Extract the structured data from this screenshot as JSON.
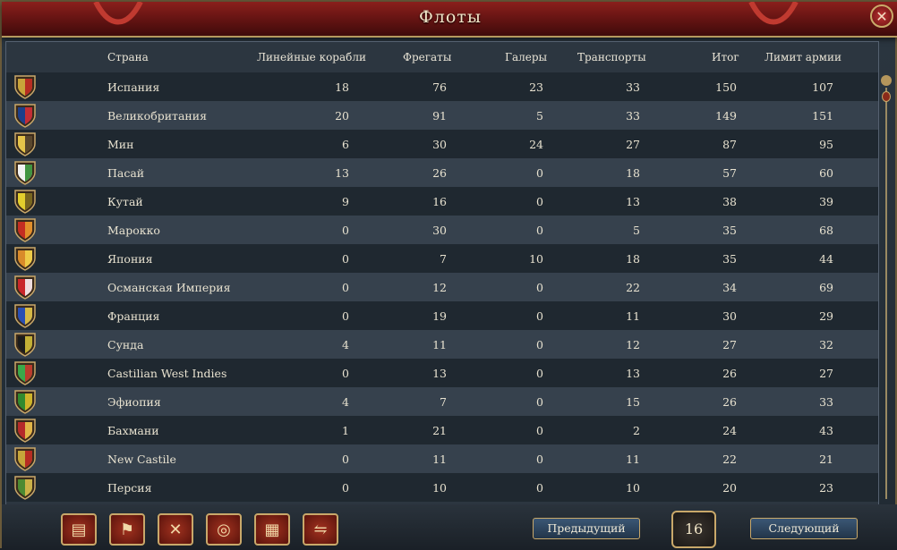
{
  "window": {
    "title": "Флоты",
    "close_icon": "close-icon"
  },
  "columns": {
    "country": "Страна",
    "line": "Линейные корабли",
    "frigates": "Фрегаты",
    "galleys": "Галеры",
    "transports": "Транспорты",
    "total": "Итог",
    "limit": "Лимит армии"
  },
  "rows": [
    {
      "name": "Испания",
      "line": "18",
      "frig": "76",
      "gal": "23",
      "trans": "33",
      "total": "150",
      "limit": "107",
      "c1": "#c8a43a",
      "c2": "#b52020"
    },
    {
      "name": "Великобритания",
      "line": "20",
      "frig": "91",
      "gal": "5",
      "trans": "33",
      "total": "149",
      "limit": "151",
      "c1": "#1d3f8a",
      "c2": "#d72b2b"
    },
    {
      "name": "Мин",
      "line": "6",
      "frig": "30",
      "gal": "24",
      "trans": "27",
      "total": "87",
      "limit": "95",
      "c1": "#e6c44a",
      "c2": "#4a3a2a"
    },
    {
      "name": "Пасай",
      "line": "13",
      "frig": "26",
      "gal": "0",
      "trans": "18",
      "total": "57",
      "limit": "60",
      "c1": "#f2f2f2",
      "c2": "#2e8a2e"
    },
    {
      "name": "Кутай",
      "line": "9",
      "frig": "16",
      "gal": "0",
      "trans": "13",
      "total": "38",
      "limit": "39",
      "c1": "#e3cf2d",
      "c2": "#6b5a1e"
    },
    {
      "name": "Марокко",
      "line": "0",
      "frig": "30",
      "gal": "0",
      "trans": "5",
      "total": "35",
      "limit": "68",
      "c1": "#c42d22",
      "c2": "#e59a2b"
    },
    {
      "name": "Япония",
      "line": "0",
      "frig": "7",
      "gal": "10",
      "trans": "18",
      "total": "35",
      "limit": "44",
      "c1": "#d98b2a",
      "c2": "#f0d24a"
    },
    {
      "name": "Османская Империя",
      "line": "0",
      "frig": "12",
      "gal": "0",
      "trans": "22",
      "total": "34",
      "limit": "69",
      "c1": "#c9262a",
      "c2": "#f3f3f3"
    },
    {
      "name": "Франция",
      "line": "0",
      "frig": "19",
      "gal": "0",
      "trans": "11",
      "total": "30",
      "limit": "29",
      "c1": "#2a4fb3",
      "c2": "#e9c43a"
    },
    {
      "name": "Сунда",
      "line": "4",
      "frig": "11",
      "gal": "0",
      "trans": "12",
      "total": "27",
      "limit": "32",
      "c1": "#1c1c1c",
      "c2": "#d6c13a"
    },
    {
      "name": "Castilian West Indies",
      "line": "0",
      "frig": "13",
      "gal": "0",
      "trans": "13",
      "total": "26",
      "limit": "27",
      "c1": "#3aa84a",
      "c2": "#c9302a"
    },
    {
      "name": "Эфиопия",
      "line": "4",
      "frig": "7",
      "gal": "0",
      "trans": "15",
      "total": "26",
      "limit": "33",
      "c1": "#2f8a2f",
      "c2": "#e0b82a"
    },
    {
      "name": "Бахмани",
      "line": "1",
      "frig": "21",
      "gal": "0",
      "trans": "2",
      "total": "24",
      "limit": "43",
      "c1": "#b52a2a",
      "c2": "#e6c44a"
    },
    {
      "name": "New Castile",
      "line": "0",
      "frig": "11",
      "gal": "0",
      "trans": "11",
      "total": "22",
      "limit": "21",
      "c1": "#c6a63a",
      "c2": "#b52020"
    },
    {
      "name": "Персия",
      "line": "0",
      "frig": "10",
      "gal": "0",
      "trans": "10",
      "total": "20",
      "limit": "23",
      "c1": "#4c8a32",
      "c2": "#d9b64a"
    }
  ],
  "footer": {
    "buttons": [
      {
        "icon": "scroll-icon"
      },
      {
        "icon": "flag-icon"
      },
      {
        "icon": "crossed-swords-icon"
      },
      {
        "icon": "coins-icon"
      },
      {
        "icon": "crate-icon"
      },
      {
        "icon": "handshake-icon"
      }
    ],
    "prev": "Предыдущий",
    "page": "16",
    "next": "Следующий"
  }
}
